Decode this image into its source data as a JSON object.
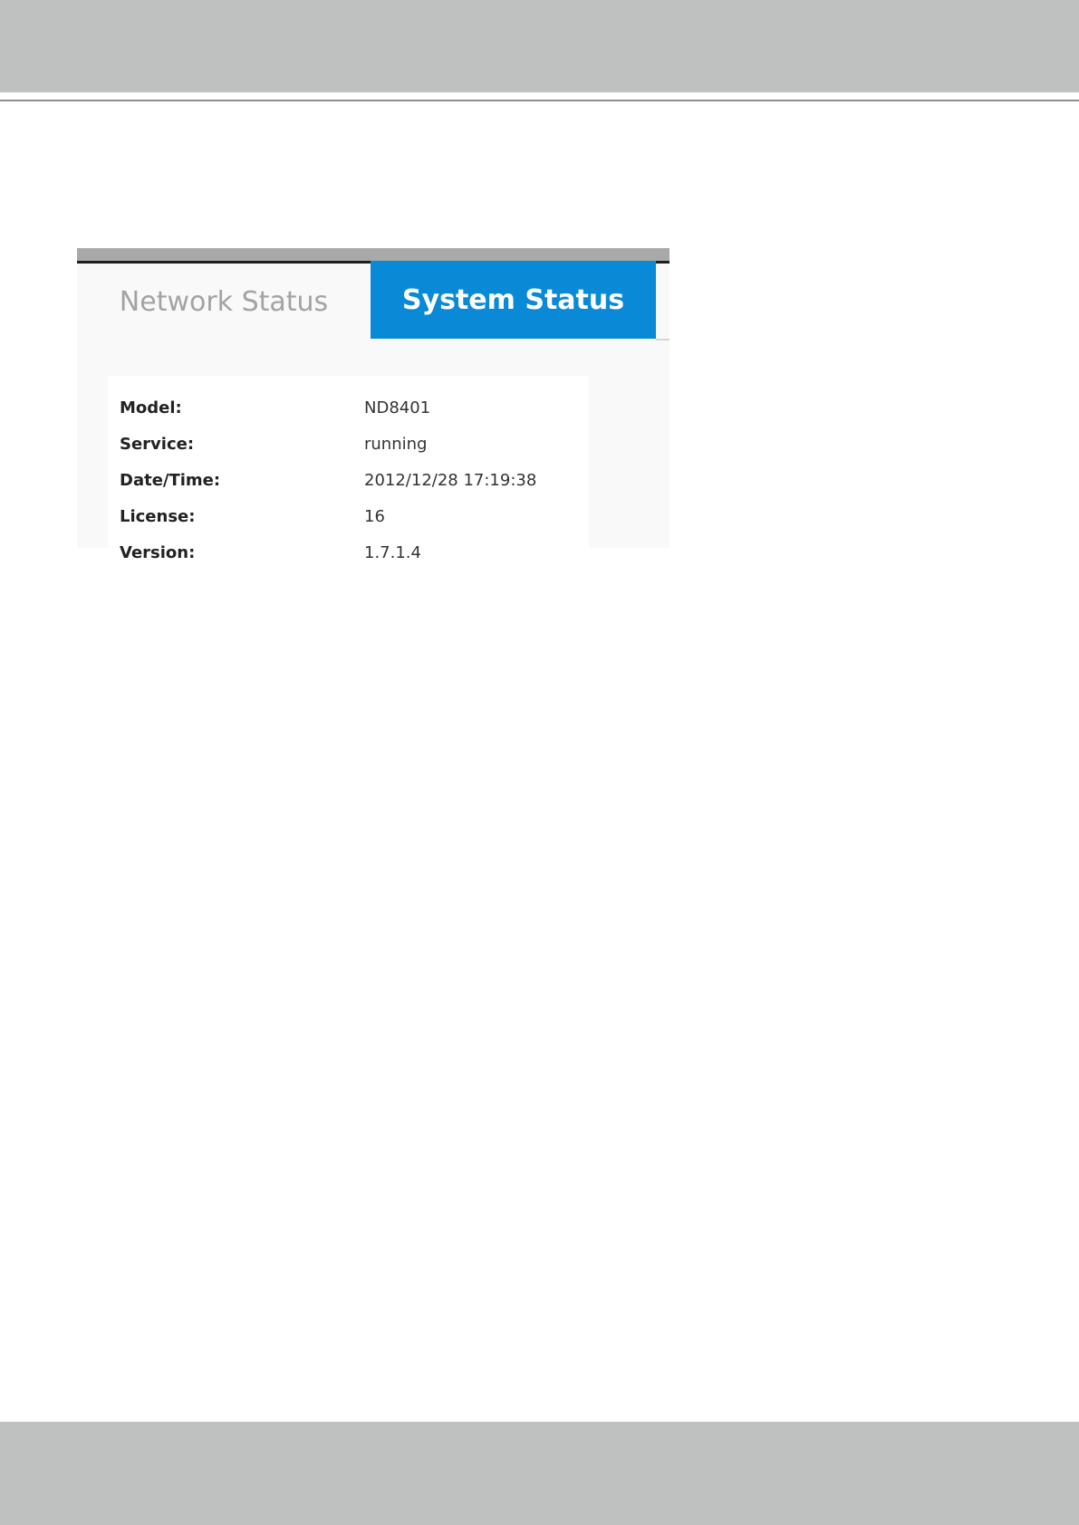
{
  "tabs": {
    "network_status": "Network Status",
    "system_status": "System Status"
  },
  "system_info": [
    {
      "label": "Model:",
      "value": "ND8401"
    },
    {
      "label": "Service:",
      "value": "running"
    },
    {
      "label": "Date/Time:",
      "value": "2012/12/28 17:19:38"
    },
    {
      "label": "License:",
      "value": "16"
    },
    {
      "label": "Version:",
      "value": "1.7.1.4"
    }
  ],
  "colors": {
    "band": "#bfc1c0",
    "active_tab": "#0a8ad6",
    "inactive_tab_text": "#a3a3a3"
  }
}
